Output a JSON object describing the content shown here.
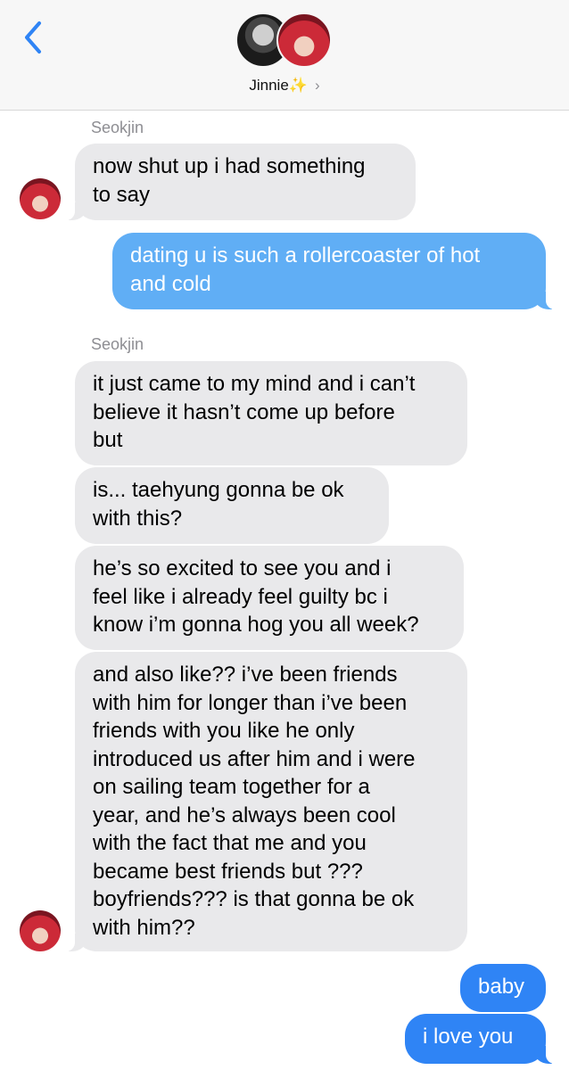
{
  "header": {
    "contact_name": "Jinnie",
    "contact_emoji": "✨",
    "chevron": "›"
  },
  "icons": {
    "back": "chevron-left-icon",
    "contact_chevron": "chevron-right-icon"
  },
  "colors": {
    "incoming_bubble": "#e9e9eb",
    "outgoing_bubble_light": "#60aef5",
    "outgoing_bubble": "#2f84f5",
    "back_arrow": "#2f84f5"
  },
  "messages": [
    {
      "sender": "Seokjin",
      "text": "now shut up i had something\nto say"
    },
    {
      "sender": "",
      "text": "dating u is such a rollercoaster of hot\nand cold"
    },
    {
      "sender": "Seokjin",
      "text": "it just came to my mind and i can’t\nbelieve it hasn’t come up before\nbut"
    },
    {
      "sender": "",
      "text": "is... taehyung gonna be ok\nwith this?"
    },
    {
      "sender": "",
      "text": "he’s so excited to see you and i\nfeel like i already feel guilty bc i\nknow i’m gonna hog you all week?"
    },
    {
      "sender": "",
      "text": "and also like?? i’ve been friends\nwith him for longer than i’ve been\nfriends with you like he only\nintroduced us after him and i were\non sailing team together for a\nyear, and he’s always been cool\nwith the fact that me and you\nbecame best friends but ???\nboyfriends??? is that gonna be ok\nwith him??"
    },
    {
      "sender": "",
      "text": "baby"
    },
    {
      "sender": "",
      "text": "i love you"
    }
  ]
}
